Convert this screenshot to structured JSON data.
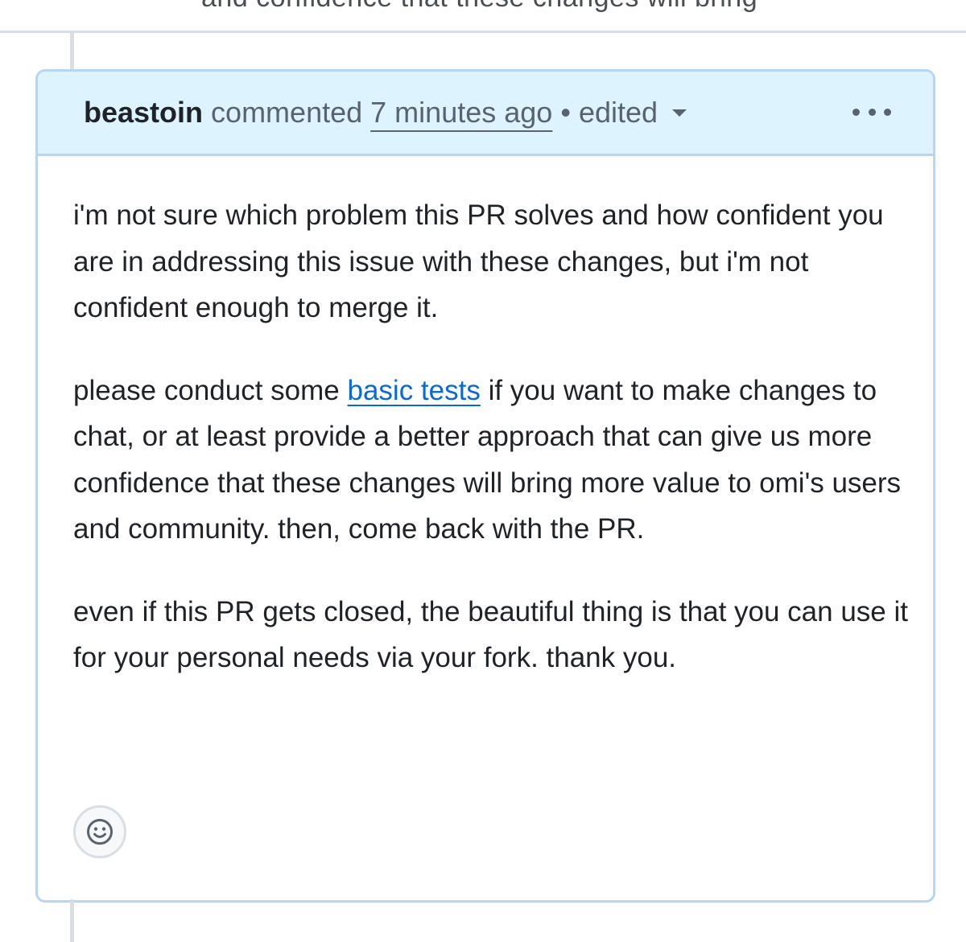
{
  "top_strip": {
    "cut_text": "and confidence that these changes will bring"
  },
  "comment": {
    "author": "beastoin",
    "action": "commented",
    "timestamp": "7 minutes ago",
    "separator": "•",
    "edited_label": "edited",
    "menu_icon": "kebab-horizontal-icon",
    "paragraph_1": "i'm not sure which problem this PR solves and how confident you are in addressing this issue with these changes, but i'm not confident enough to merge it.",
    "paragraph_2_before_link": "please conduct some ",
    "paragraph_2_link": "basic tests",
    "paragraph_2_after_link": " if you want to make changes to chat, or at least provide a better approach that can give us more confidence that these changes will bring more value to omi's users and community. then, come back with the PR.",
    "paragraph_3": "even if this PR gets closed, the beautiful thing is that you can use it for your personal needs via your fork. thank you.",
    "reaction_icon": "smiley-icon"
  },
  "colors": {
    "header_bg": "#ddf4ff",
    "border": "#b6d6f5",
    "link": "#0969da",
    "muted_text": "#59636e",
    "text": "#1f2328"
  }
}
